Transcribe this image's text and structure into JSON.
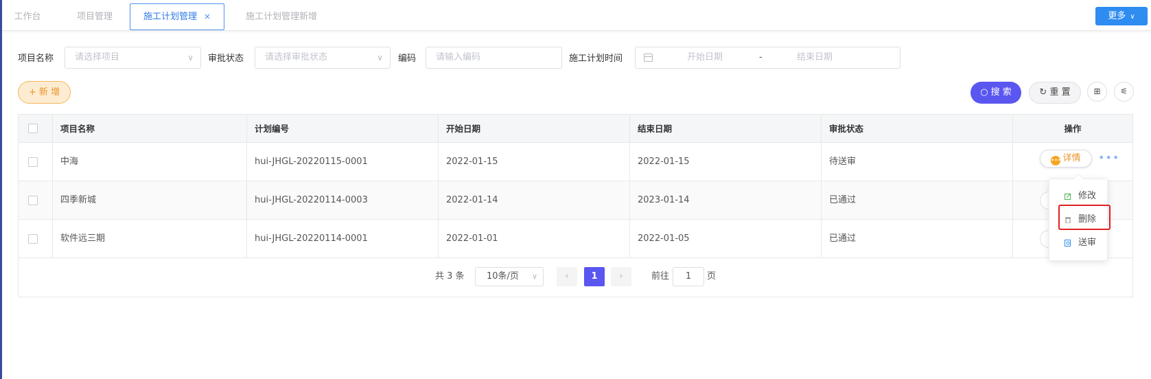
{
  "tabs": [
    {
      "label": "工作台"
    },
    {
      "label": "项目管理"
    },
    {
      "label": "施工计划管理",
      "close": "×"
    },
    {
      "label": "施工计划管理新增"
    }
  ],
  "header": {
    "more_label": "更多",
    "more_chevron": "∨"
  },
  "search": {
    "project_label": "项目名称",
    "project_placeholder": "请选择项目",
    "status_label": "审批状态",
    "status_placeholder": "请选择审批状态",
    "code_label": "编码",
    "code_placeholder": "请输入编码",
    "time_label": "施工计划时间",
    "start_placeholder": "开始日期",
    "date_separator": "-",
    "end_placeholder": "结束日期"
  },
  "actions": {
    "add_label": "+ 新 增",
    "search_label": "搜 索",
    "search_icon": "○",
    "reset_label": "重 置",
    "reset_icon": "↻",
    "grid_icon": "⊞",
    "filter_icon": "⚟"
  },
  "table": {
    "columns": [
      "项目名称",
      "计划编号",
      "开始日期",
      "结束日期",
      "审批状态",
      "操作"
    ],
    "rows": [
      {
        "name": "中海",
        "code": "hui-JHGL-20220115-0001",
        "start": "2022-01-15",
        "end": "2022-01-15",
        "status": "待送审"
      },
      {
        "name": "四季新城",
        "code": "hui-JHGL-20220114-0003",
        "start": "2022-01-14",
        "end": "2023-01-14",
        "status": "已通过"
      },
      {
        "name": "软件远三期",
        "code": "hui-JHGL-20220114-0001",
        "start": "2022-01-01",
        "end": "2022-01-05",
        "status": "已通过"
      }
    ],
    "detail_label": "详情",
    "detail_icon": "•••",
    "more_dots": "•••"
  },
  "pagination": {
    "total_text": "共 3 条",
    "page_size": "10条/页",
    "prev": "‹",
    "current_page": "1",
    "next": "›",
    "goto_label": "前往",
    "goto_value": "1",
    "goto_unit": "页"
  },
  "dropdown": {
    "items": [
      "修改",
      "删除",
      "送审"
    ]
  },
  "colors": {
    "primary": "#5a56f0",
    "tab_active": "#2f7be8",
    "more_button": "#2f8cf0",
    "add_button": "#e9952a",
    "highlight": "#e02020"
  }
}
